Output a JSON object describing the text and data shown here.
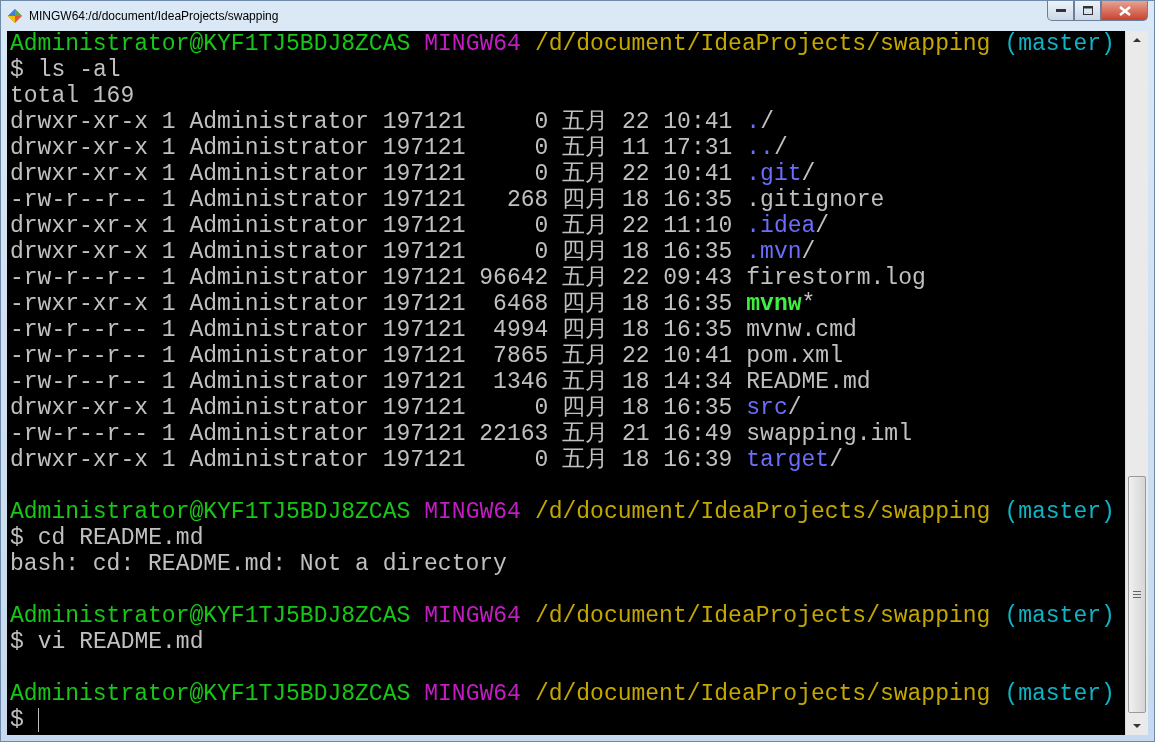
{
  "window": {
    "title": "MINGW64:/d/document/IdeaProjects/swapping"
  },
  "lines": [
    {
      "kind": "prompt",
      "user": "Administrator@KYF1TJ5BDJ8ZCAS",
      "system": "MINGW64",
      "path": "/d/document/IdeaProjects/swapping",
      "branch": "(master)"
    },
    {
      "kind": "command",
      "prompt": "$",
      "text": "ls -al"
    },
    {
      "kind": "output",
      "text": "total 169"
    },
    {
      "kind": "entry",
      "info": "drwxr-xr-x 1 Administrator 197121     0 五月 22 10:41",
      "file": {
        "kind": "dir",
        "name": ".",
        "suffix": "/"
      }
    },
    {
      "kind": "entry",
      "info": "drwxr-xr-x 1 Administrator 197121     0 五月 11 17:31",
      "file": {
        "kind": "dir",
        "name": "..",
        "suffix": "/"
      }
    },
    {
      "kind": "entry",
      "info": "drwxr-xr-x 1 Administrator 197121     0 五月 22 10:41",
      "file": {
        "kind": "dir",
        "name": ".git",
        "suffix": "/"
      }
    },
    {
      "kind": "entry",
      "info": "-rw-r--r-- 1 Administrator 197121   268 四月 18 16:35",
      "file": {
        "kind": "plain",
        "name": ".gitignore"
      }
    },
    {
      "kind": "entry",
      "info": "drwxr-xr-x 1 Administrator 197121     0 五月 22 11:10",
      "file": {
        "kind": "dir",
        "name": ".idea",
        "suffix": "/"
      }
    },
    {
      "kind": "entry",
      "info": "drwxr-xr-x 1 Administrator 197121     0 四月 18 16:35",
      "file": {
        "kind": "dir",
        "name": ".mvn",
        "suffix": "/"
      }
    },
    {
      "kind": "entry",
      "info": "-rw-r--r-- 1 Administrator 197121 96642 五月 22 09:43",
      "file": {
        "kind": "plain",
        "name": "firestorm.log"
      }
    },
    {
      "kind": "entry",
      "info": "-rwxr-xr-x 1 Administrator 197121  6468 四月 18 16:35",
      "file": {
        "kind": "exec",
        "name": "mvnw",
        "suffix": "*"
      }
    },
    {
      "kind": "entry",
      "info": "-rw-r--r-- 1 Administrator 197121  4994 四月 18 16:35",
      "file": {
        "kind": "plain",
        "name": "mvnw.cmd"
      }
    },
    {
      "kind": "entry",
      "info": "-rw-r--r-- 1 Administrator 197121  7865 五月 22 10:41",
      "file": {
        "kind": "plain",
        "name": "pom.xml"
      }
    },
    {
      "kind": "entry",
      "info": "-rw-r--r-- 1 Administrator 197121  1346 五月 18 14:34",
      "file": {
        "kind": "plain",
        "name": "README.md"
      }
    },
    {
      "kind": "entry",
      "info": "drwxr-xr-x 1 Administrator 197121     0 四月 18 16:35",
      "file": {
        "kind": "dir",
        "name": "src",
        "suffix": "/"
      }
    },
    {
      "kind": "entry",
      "info": "-rw-r--r-- 1 Administrator 197121 22163 五月 21 16:49",
      "file": {
        "kind": "plain",
        "name": "swapping.iml"
      }
    },
    {
      "kind": "entry",
      "info": "drwxr-xr-x 1 Administrator 197121     0 五月 18 16:39",
      "file": {
        "kind": "dir",
        "name": "target",
        "suffix": "/"
      }
    },
    {
      "kind": "blank"
    },
    {
      "kind": "prompt",
      "user": "Administrator@KYF1TJ5BDJ8ZCAS",
      "system": "MINGW64",
      "path": "/d/document/IdeaProjects/swapping",
      "branch": "(master)"
    },
    {
      "kind": "command",
      "prompt": "$",
      "text": "cd README.md"
    },
    {
      "kind": "output",
      "text": "bash: cd: README.md: Not a directory"
    },
    {
      "kind": "blank"
    },
    {
      "kind": "prompt",
      "user": "Administrator@KYF1TJ5BDJ8ZCAS",
      "system": "MINGW64",
      "path": "/d/document/IdeaProjects/swapping",
      "branch": "(master)"
    },
    {
      "kind": "command",
      "prompt": "$",
      "text": "vi README.md"
    },
    {
      "kind": "blank"
    },
    {
      "kind": "prompt",
      "user": "Administrator@KYF1TJ5BDJ8ZCAS",
      "system": "MINGW64",
      "path": "/d/document/IdeaProjects/swapping",
      "branch": "(master)"
    },
    {
      "kind": "input",
      "prompt": "$"
    }
  ]
}
